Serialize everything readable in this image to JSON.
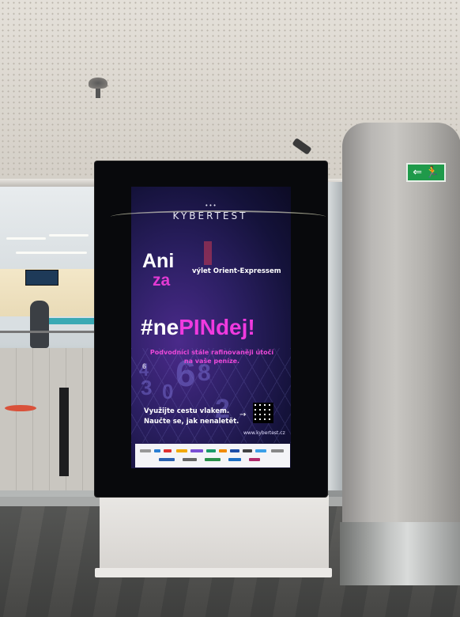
{
  "sign": {
    "dots": "•••",
    "brand": "KYBERTEST",
    "ani": "Ani",
    "za": "za",
    "trip": "výlet Orient-Expressem",
    "hashtag_prefix": "#ne",
    "hashtag_middle": "PIN",
    "hashtag_suffix": "dej!",
    "subline_1": "Podvodníci stále rafinovaněji útočí",
    "subline_2": "na vaše peníze.",
    "cta_1": "Využijte cestu vlakem.",
    "cta_2": "Naučte se, jak nenaletět.",
    "arrow": "→",
    "url": "www.kybertest.cz"
  },
  "exit_sign": {
    "symbol": "⇐ 🏃"
  },
  "colors": {
    "accent_pink": "#f03adf",
    "screen_bg": "#2b1f62",
    "exit_green": "#1f9a4a"
  }
}
